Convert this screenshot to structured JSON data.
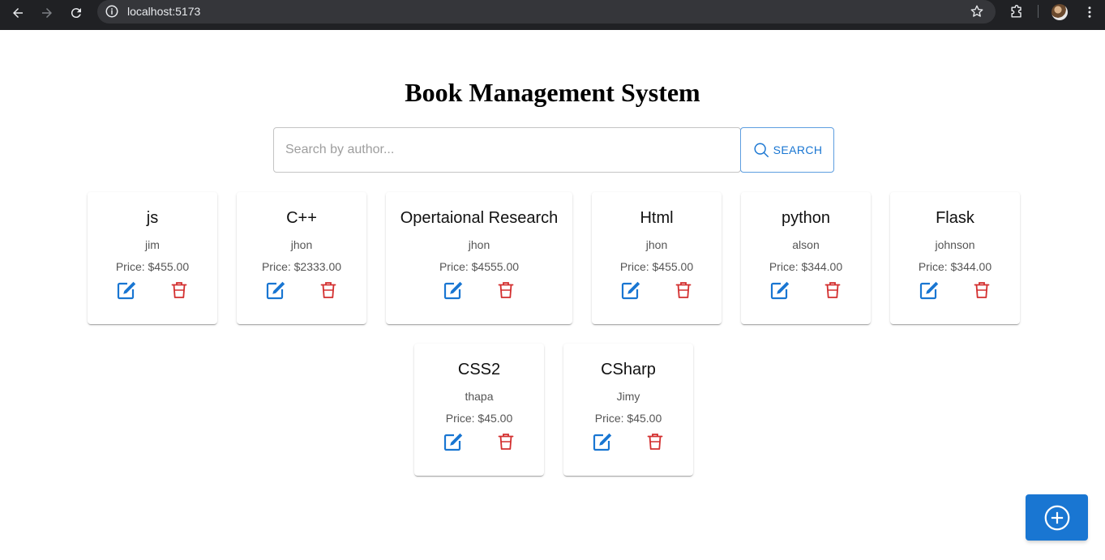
{
  "browser": {
    "url": "localhost:5173",
    "icons": [
      "back-arrow-icon",
      "forward-arrow-icon",
      "reload-icon",
      "site-info-icon",
      "bookmark-star-icon",
      "extensions-icon",
      "profile-avatar",
      "menu-dots-icon"
    ]
  },
  "page": {
    "title": "Book Management System"
  },
  "search": {
    "placeholder": "Search by author...",
    "value": "",
    "button_label": "SEARCH"
  },
  "books": [
    {
      "title": "js",
      "author": "jim",
      "price": "Price: $455.00"
    },
    {
      "title": "C++",
      "author": "jhon",
      "price": "Price: $2333.00"
    },
    {
      "title": "Opertaional Research",
      "author": "jhon",
      "price": "Price: $4555.00"
    },
    {
      "title": "Html",
      "author": "jhon",
      "price": "Price: $455.00"
    },
    {
      "title": "python",
      "author": "alson",
      "price": "Price: $344.00"
    },
    {
      "title": "Flask",
      "author": "johnson",
      "price": "Price: $344.00"
    },
    {
      "title": "CSS2",
      "author": "thapa",
      "price": "Price: $45.00"
    },
    {
      "title": "CSharp",
      "author": "Jimy",
      "price": "Price: $45.00"
    }
  ],
  "card_icons": {
    "edit": "edit-icon",
    "delete": "delete-trash-icon"
  },
  "fab": {
    "icon": "add-circle-icon"
  },
  "colors": {
    "primary": "#1976d2",
    "danger": "#d32f2f",
    "chrome_bar": "#202124",
    "omnibox": "#35363a"
  }
}
